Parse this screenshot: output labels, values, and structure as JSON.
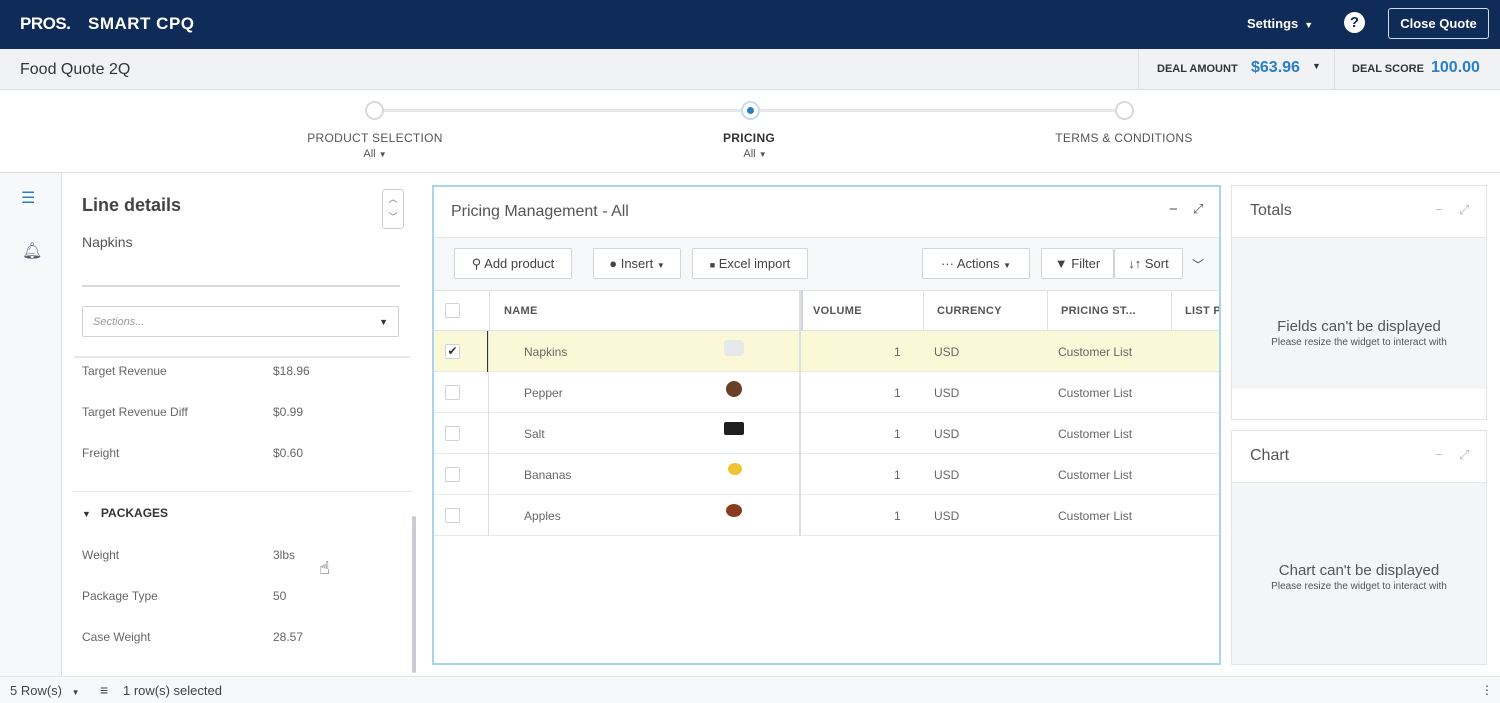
{
  "header": {
    "brand": "PROS.",
    "app_name": "SMART CPQ",
    "settings_label": "Settings",
    "help_label": "?",
    "close_quote_label": "Close Quote"
  },
  "quote": {
    "title": "Food Quote 2Q",
    "deal_amount_label": "DEAL AMOUNT",
    "deal_amount_value": "$63.96",
    "deal_score_label": "DEAL SCORE",
    "deal_score_value": "100.00"
  },
  "steps": [
    {
      "label": "PRODUCT SELECTION",
      "sub": "All"
    },
    {
      "label": "PRICING",
      "sub": "All"
    },
    {
      "label": "TERMS & CONDITIONS",
      "sub": ""
    }
  ],
  "line_details": {
    "title": "Line details",
    "product": "Napkins",
    "sections_placeholder": "Sections...",
    "fields": [
      {
        "label": "Target Revenue",
        "value": "$18.96"
      },
      {
        "label": "Target Revenue Diff",
        "value": "$0.99"
      },
      {
        "label": "Freight",
        "value": "$0.60"
      }
    ],
    "packages_header": "PACKAGES",
    "package_fields": [
      {
        "label": "Weight",
        "value": "3lbs"
      },
      {
        "label": "Package Type",
        "value": "50"
      },
      {
        "label": "Case Weight",
        "value": "28.57"
      }
    ]
  },
  "pricing": {
    "title": "Pricing Management - All",
    "toolbar": {
      "add_product": "Add product",
      "insert": "Insert",
      "excel_import": "Excel import",
      "actions": "Actions",
      "filter": "Filter",
      "sort": "Sort"
    },
    "columns": [
      "NAME",
      "VOLUME",
      "CURRENCY",
      "PRICING ST...",
      "LIST PR"
    ],
    "rows": [
      {
        "name": "Napkins",
        "volume": "1",
        "currency": "USD",
        "pricing": "Customer List",
        "color": "#e6e8ec",
        "checked": true
      },
      {
        "name": "Pepper",
        "volume": "1",
        "currency": "USD",
        "pricing": "Customer List",
        "color": "#6b3f26",
        "checked": false
      },
      {
        "name": "Salt",
        "volume": "1",
        "currency": "USD",
        "pricing": "Customer List",
        "color": "#1f1f1f",
        "checked": false
      },
      {
        "name": "Bananas",
        "volume": "1",
        "currency": "USD",
        "pricing": "Customer List",
        "color": "#f0c330",
        "checked": false
      },
      {
        "name": "Apples",
        "volume": "1",
        "currency": "USD",
        "pricing": "Customer List",
        "color": "#8a3a1e",
        "checked": false
      }
    ]
  },
  "totals": {
    "title": "Totals",
    "message": "Fields can't be displayed",
    "sub": "Please resize the widget to interact with"
  },
  "chart": {
    "title": "Chart",
    "message": "Chart can't be displayed",
    "sub": "Please resize the widget to interact with"
  },
  "footer": {
    "rows_label": "5 Row(s)",
    "selected_label": "1 row(s) selected"
  },
  "colors": {
    "navy": "#0f2b57",
    "accent": "#2a7fc5",
    "selected_row": "#fbf8d7"
  }
}
